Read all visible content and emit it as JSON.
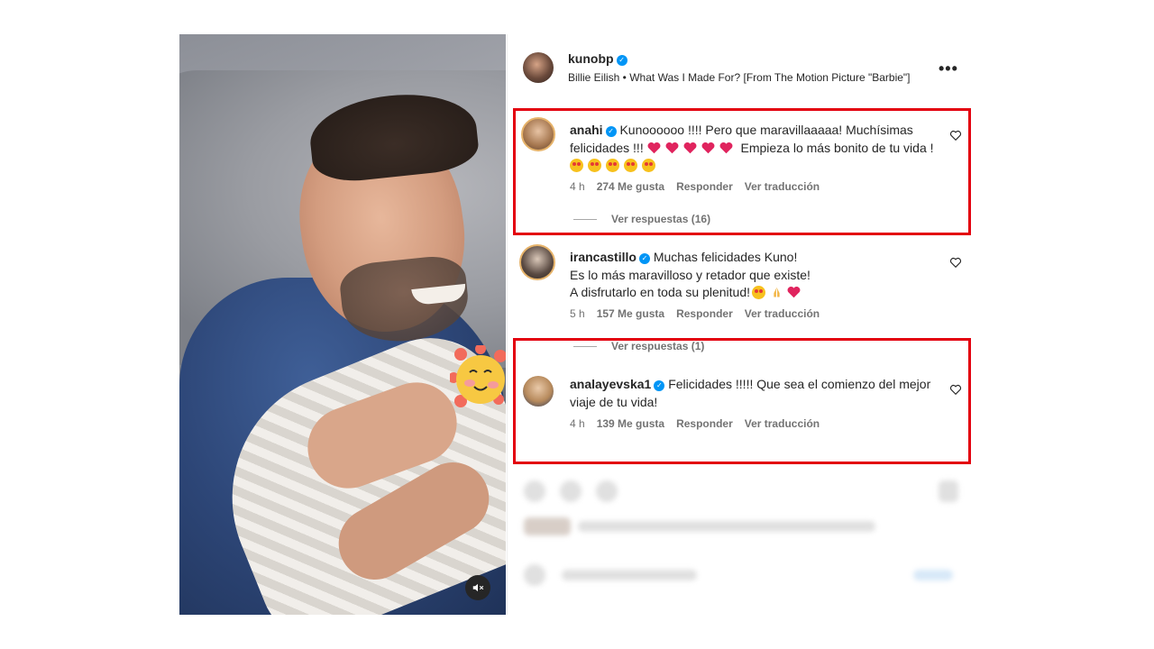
{
  "post": {
    "username": "kunobp",
    "song": "Billie Eilish • What Was I Made For? [From The Motion Picture \"Barbie\"]",
    "more_label": "•••"
  },
  "comments": [
    {
      "username": "anahi",
      "text_before": "Kunoooooo !!!! Pero que maravillaaaaa! Muchísimas felicidades !!! ",
      "text_middle": " Empieza lo más bonito de tu vida ! ",
      "time": "4 h",
      "likes": "274 Me gusta",
      "reply": "Responder",
      "translate": "Ver traducción",
      "view_replies": "Ver respuestas (16)"
    },
    {
      "username": "irancastillo",
      "line1": "Muchas felicidades Kuno!",
      "line2": "Es lo más maravilloso y retador que existe!",
      "line3": "A disfrutarlo en toda su plenitud!",
      "time": "5 h",
      "likes": "157 Me gusta",
      "reply": "Responder",
      "translate": "Ver traducción",
      "view_replies": "Ver respuestas (1)"
    },
    {
      "username": "analayevska1",
      "text": "Felicidades !!!!! Que sea el comienzo del mejor viaje de tu vida!",
      "time": "4 h",
      "likes": "139 Me gusta",
      "reply": "Responder",
      "translate": "Ver traducción"
    }
  ],
  "colors": {
    "highlight": "#e3000f",
    "verified": "#0095f6",
    "heart_emoji": "#e0245e"
  },
  "icons": {
    "mute": "speaker-muted-icon",
    "like": "heart-outline-icon",
    "verified": "verified-badge-icon"
  }
}
